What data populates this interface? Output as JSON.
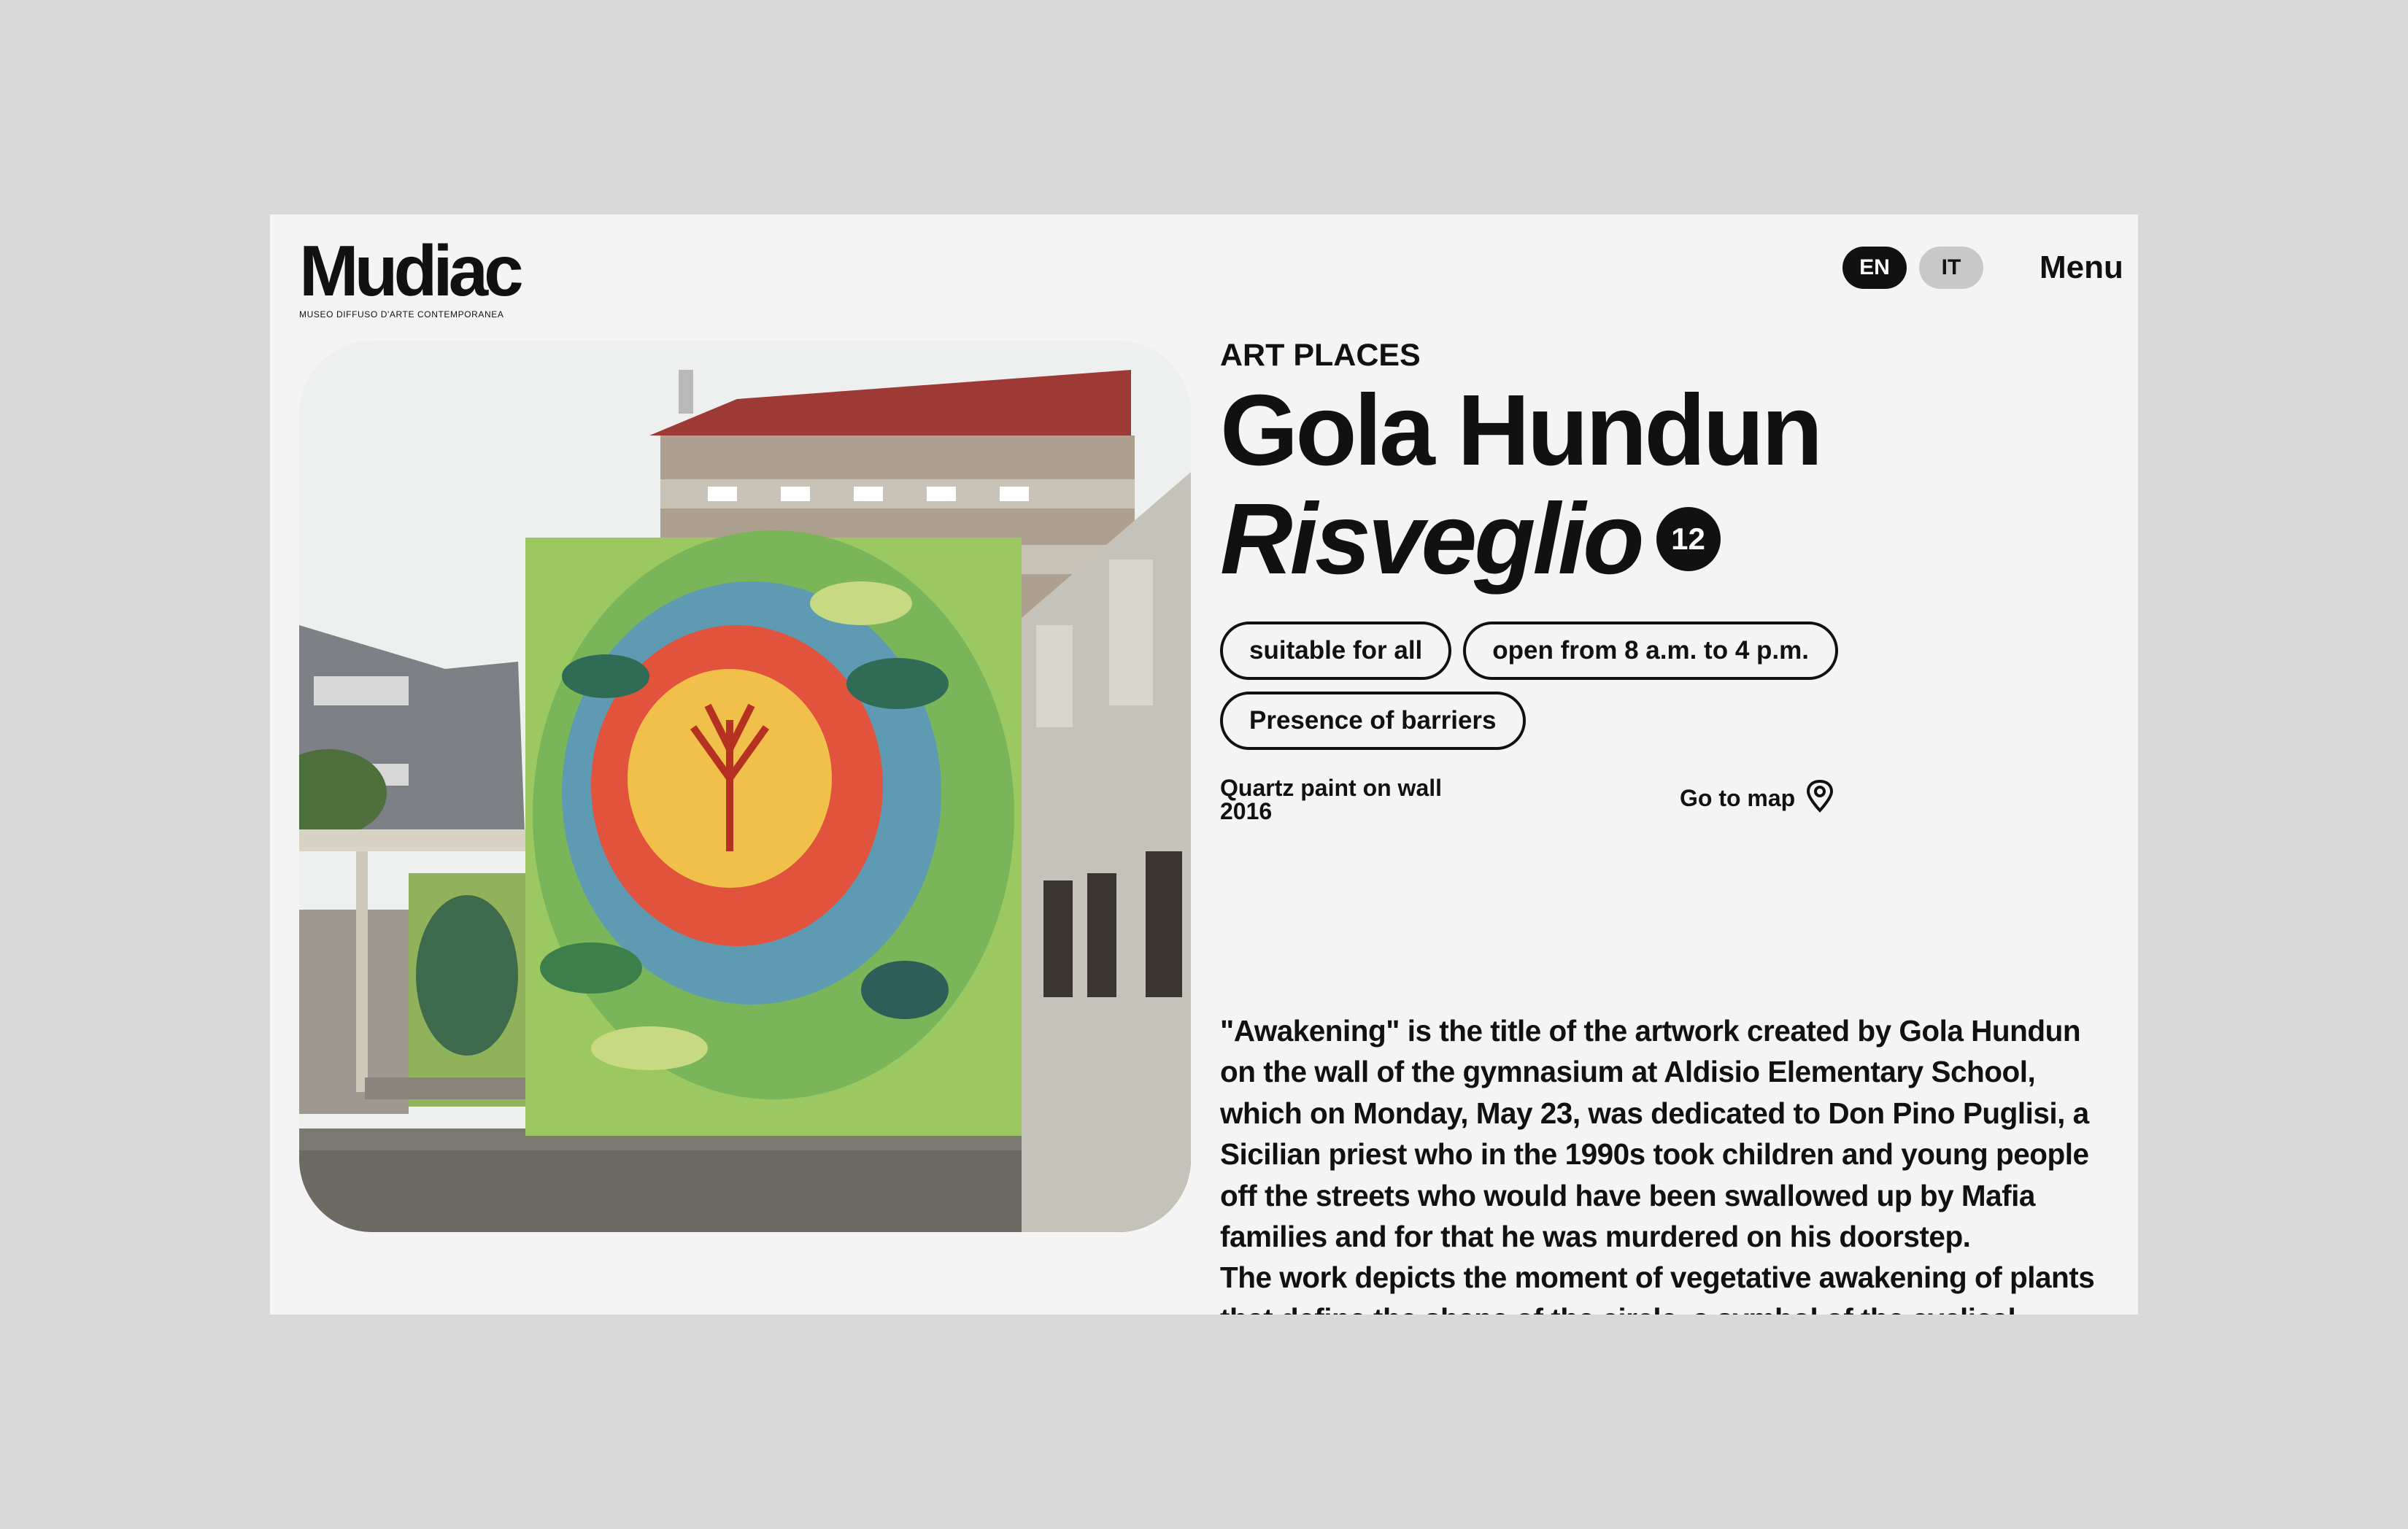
{
  "header": {
    "logo_text": "Mudiac",
    "logo_subtitle": "MUSEO DIFFUSO D'ARTE CONTEMPORANEA",
    "lang_en": "EN",
    "lang_it": "IT",
    "menu_label": "Menu"
  },
  "artwork": {
    "category": "ART PLACES",
    "artist": "Gola Hundun",
    "title": "Risveglio",
    "number": "12",
    "tags": [
      "suitable for all",
      "open from 8 a.m. to 4 p.m.",
      "Presence of barriers"
    ],
    "medium": "Quartz paint on wall",
    "year": "2016",
    "map_link": "Go to map",
    "description": [
      "\"Awakening\" is the title of the artwork created by Gola Hundun on the wall of the gymnasium at Aldisio Elementary School, which on Monday, May 23, was dedicated to Don Pino Puglisi, a Sicilian priest who in the 1990s took children and young people off the streets who would have been swallowed up by Mafia families and for that he was murdered on his doorstep.",
      "The work depicts the moment of vegetative awakening of plants that define the shape of the circle, a symbol of the cyclical"
    ]
  },
  "colors": {
    "background": "#d9d9d9",
    "card": "#f4f4f4",
    "text": "#111111",
    "lang_active": "#111111",
    "lang_inactive": "#c8c8c8"
  },
  "icons": {
    "map": "map-pin-icon"
  }
}
